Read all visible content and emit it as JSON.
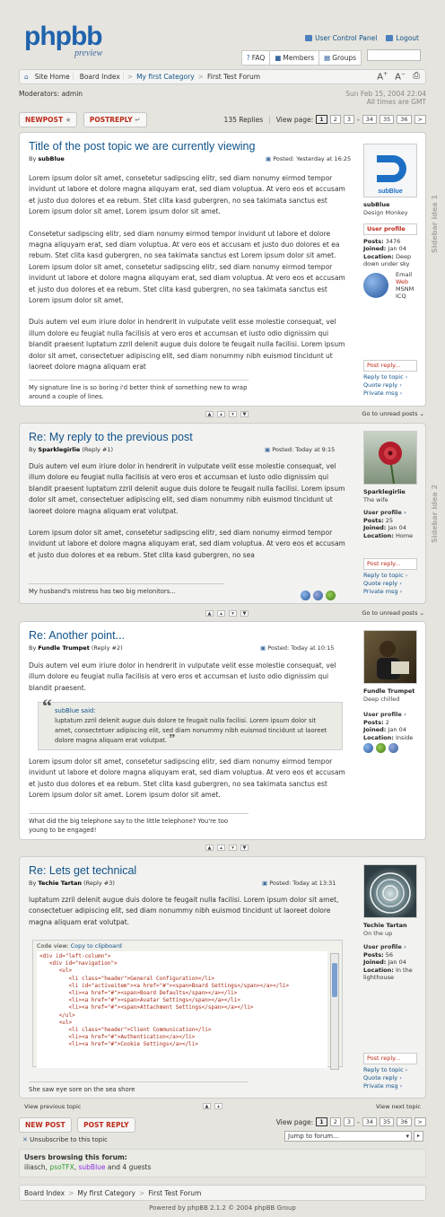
{
  "header": {
    "logo_main": "phpbb",
    "logo_sub": "preview",
    "ucp_label": "User Control Panel",
    "logout_label": "Logout",
    "tabs": [
      "FAQ",
      "Members",
      "Groups"
    ]
  },
  "navbar": {
    "crumbs": [
      "Site Home",
      "Board Index",
      "My first Category",
      "First Test Forum"
    ],
    "font_up": "A",
    "font_down": "A"
  },
  "forum_info": {
    "moderators_label": "Moderators:",
    "moderators_value": "admin",
    "date": "Sun Feb 15, 2004 22:04",
    "timezone": "All times are GMT"
  },
  "actions": {
    "newpost": "NEWPOST",
    "postreply": "POSTREPLY",
    "replies": "135 Replies",
    "view_page": "View page:",
    "pages": [
      "1",
      "2",
      "3",
      "34",
      "35",
      "36"
    ]
  },
  "posts": [
    {
      "title": "Title of the post topic we are currently viewing",
      "by": "By",
      "author": "subBlue",
      "reply_no": "",
      "posted": "Posted: Yesterday at 16:25",
      "body": [
        "Lorem ipsum dolor sit amet, consetetur sadipscing elitr, sed diam nonumy eirmod tempor invidunt ut labore et dolore magna aliquyam erat, sed diam voluptua. At vero eos et accusam et justo duo dolores et ea rebum. Stet clita kasd gubergren, no sea takimata sanctus est Lorem ipsum dolor sit amet. Lorem ipsum dolor sit amet.",
        "Consetetur sadipscing elitr, sed diam nonumy eirmod tempor invidunt ut labore et dolore magna aliquyam erat, sed diam voluptua. At vero eos et accusam et justo duo dolores et ea rebum. Stet clita kasd gubergren, no sea takimata sanctus est Lorem ipsum dolor sit amet. Lorem ipsum dolor sit amet, consetetur sadipscing elitr, sed diam nonumy eirmod tempor invidunt ut labore et dolore magna aliquyam erat, sed diam voluptua. At vero eos et accusam et justo duo dolores et ea rebum. Stet clita kasd gubergren, no sea takimata sanctus est Lorem ipsum dolor sit amet.",
        "Duis autem vel eum iriure dolor in hendrerit in vulputate velit esse molestie consequat, vel illum dolore eu feugiat nulla facilisis at vero eros et accumsan et iusto odio dignissim qui blandit praesent luptatum zzril delenit augue duis dolore te feugait nulla facilisi. Lorem ipsum dolor sit amet, consectetuer adipiscing elit, sed diam nonummy nibh euismod tincidunt ut laoreet dolore magna aliquam erat"
      ],
      "signature": "My signature line is so boring i'd better think of something new to wrap around a couple of lines.",
      "rank": "Design Monkey",
      "profile_label": "User profile",
      "posts_label": "Posts:",
      "posts_value": "3476",
      "joined_label": "Joined:",
      "joined_value": "Jan 04",
      "location_label": "Location:",
      "location_value": "Deep down under sky",
      "contact": [
        "Email",
        "Web",
        "MSNM",
        "ICQ"
      ],
      "post_reply": "Post reply...",
      "tools": [
        "Reply to topic",
        "Quote reply",
        "Private msg"
      ],
      "sidebar": "Sidebar idea 1"
    },
    {
      "title": "Re: My reply to the previous post",
      "by": "By",
      "author": "Sparklegirlie",
      "reply_no": "(Reply #1)",
      "posted": "Posted: Today at 9:15",
      "body": [
        "Duis autem vel eum iriure dolor in hendrerit in vulputate velit esse molestie consequat, vel illum dolore eu feugiat nulla facilisis at vero eros et accumsan et iusto odio dignissim qui blandit praesent luptatum zzril delenit augue duis dolore te feugait nulla facilisi. Lorem ipsum dolor sit amet, consectetuer adipiscing elit, sed diam nonummy nibh euismod tincidunt ut laoreet dolore magna aliquam erat volutpat.",
        "Lorem ipsum dolor sit amet, consetetur sadipscing elitr, sed diam nonumy eirmod tempor invidunt ut labore et dolore magna aliquyam erat, sed diam voluptua. At vero eos et accusam et justo duo dolores et ea rebum. Stet clita kasd gubergren, no sea"
      ],
      "signature": "My husband's mistress has two big melonitors...",
      "rank": "The wife",
      "profile_label": "User profile",
      "posts_label": "Posts:",
      "posts_value": "25",
      "joined_label": "Joined:",
      "joined_value": "Jan 04",
      "location_label": "Location:",
      "location_value": "Home",
      "post_reply": "Post reply...",
      "tools": [
        "Reply to topic",
        "Quote reply",
        "Private msg"
      ],
      "sidebar": "Sidebar idea 2"
    },
    {
      "title": "Re: Another point...",
      "by": "By",
      "author": "Fundle Trumpet",
      "reply_no": "(Reply #2)",
      "posted": "Posted: Today at 10:15",
      "body": [
        "Duis autem vel eum iriure dolor in hendrerit in vulputate velit esse molestie consequat, vel illum dolore eu feugiat nulla facilisis at vero eros et accumsan et iusto odio dignissim qui blandit praesent.",
        "Lorem ipsum dolor sit amet, consetetur sadipscing elitr, sed diam nonumy eirmod tempor invidunt ut labore et dolore magna aliquyam erat, sed diam voluptua. At vero eos et accusam et justo duo dolores et ea rebum. Stet clita kasd gubergren, no sea takimata sanctus est Lorem ipsum dolor sit amet. Lorem ipsum dolor sit amet."
      ],
      "quote_author": "subBlue said:",
      "quote_text": "luptatum zzril delenit augue duis dolore te feugait nulla facilisi. Lorem ipsum dolor sit amet, consectetuer adipiscing elit, sed diam nonummy nibh euismod tincidunt ut laoreet dolore magna aliquam erat volutpat.",
      "signature": "What did the big telephone say to the little telephone? You're too young to be engaged!",
      "rank": "Deep chilled",
      "profile_label": "User profile",
      "posts_label": "Posts:",
      "posts_value": "2",
      "joined_label": "Joined:",
      "joined_value": "Jan 04",
      "location_label": "Location:",
      "location_value": "Inside"
    },
    {
      "title": "Re: Lets get technical",
      "by": "By",
      "author": "Techie Tartan",
      "reply_no": "(Reply #3)",
      "posted": "Posted: Today at 13:31",
      "body": [
        "luptatum zzril delenit augue duis dolore te feugait nulla facilisi. Lorem ipsum dolor sit amet, consectetuer adipiscing elit, sed diam nonummy nibh euismod tincidunt ut laoreet dolore magna aliquam erat volutpat."
      ],
      "code_label": "Code view:",
      "code_copy": "Copy to clipboard",
      "code": "<div id=\"left-column\">\n   <div id=\"navigation\">\n      <ul>\n         <li class=\"header\">General Configuration</li>\n         <li id=\"activeitem\"><a href=\"#\"><span>Board Settings</span></a></li>\n         <li><a href=\"#\"><span>Board Defaults</span></a></li>\n         <li><a href=\"#\"><span>Avatar Settings</span></a></li>\n         <li><a href=\"#\"><span>Attachment Settings</span></a></li>\n      </ul>\n      <ul>\n         <li class=\"header\">Client Communication</li>\n         <li><a href=\"#\">Authentication</a></li>\n         <li><a href=\"#\">Cookie Settings</a></li>",
      "signature": "She saw eye sore on the sea shore",
      "rank": "On the up",
      "profile_label": "User profile",
      "posts_label": "Posts:",
      "posts_value": "56",
      "joined_label": "Joined:",
      "joined_value": "Jan 04",
      "location_label": "Location:",
      "location_value": "In the lighthouse",
      "post_reply": "Post reply...",
      "tools": [
        "Reply to topic",
        "Quote reply",
        "Private msg"
      ]
    }
  ],
  "go_unread": "Go to unread posts",
  "view_prev": "View previous topic",
  "view_next": "View next topic",
  "bottom": {
    "newpost": "NEW POST",
    "postreply": "POST REPLY",
    "view_page": "View page:",
    "pages": [
      "1",
      "2",
      "3",
      "34",
      "35",
      "36"
    ],
    "unsubscribe": "Unsubscribe to this topic",
    "jump": "Jump to forum..."
  },
  "browsing": {
    "title": "Users browsing this forum:",
    "users": [
      "iliasch",
      "psoTFX",
      "subBlue"
    ],
    "guests": "and 4 guests"
  },
  "footer_crumbs": [
    "Board Index",
    "My first Category",
    "First Test Forum"
  ],
  "powered": "Powered by phpBB 2.1.2 © 2004 phpBB Group"
}
